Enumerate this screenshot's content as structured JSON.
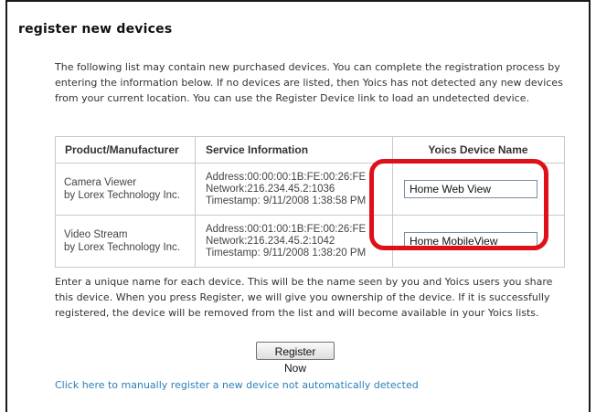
{
  "page": {
    "heading": "register new devices",
    "intro": "The following list may contain new purchased devices. You can complete the registration process by entering the information below. If no devices are listed, then Yoics has not detected any new devices from your current location. You can use the Register Device link to load an undetected device."
  },
  "table": {
    "headers": [
      "Product/Manufacturer",
      "Service Information",
      "Yoics Device Name"
    ],
    "rows": [
      {
        "product": "Camera Viewer",
        "manufacturer": "by Lorex Technology Inc.",
        "address": "Address:00:00:00:1B:FE:00:26:FE",
        "network": "Network:216.234.45.2:1036",
        "timestamp": "Timestamp: 9/11/2008 1:38:58 PM",
        "device_name": "Home Web View"
      },
      {
        "product": "Video Stream",
        "manufacturer": "by Lorex Technology Inc.",
        "address": "Address:00:01:00:1B:FE:00:26:FE",
        "network": "Network:216.234.45.2:1042",
        "timestamp": "Timestamp: 9/11/2008 1:38:20 PM",
        "device_name": "Home MobileView"
      }
    ]
  },
  "outro": "Enter a unique name for each device. This will be the name seen by you and Yoics users you share this device. When you press Register, we will give you ownership of the device. If it is successfully registered, the device will be removed from the list and will become available in your Yoics lists.",
  "register_button": "Register Now",
  "manual_link": "Click here to manually register a new device not automatically detected",
  "colors": {
    "highlight": "#e0101a",
    "link": "#2b7fb8"
  }
}
